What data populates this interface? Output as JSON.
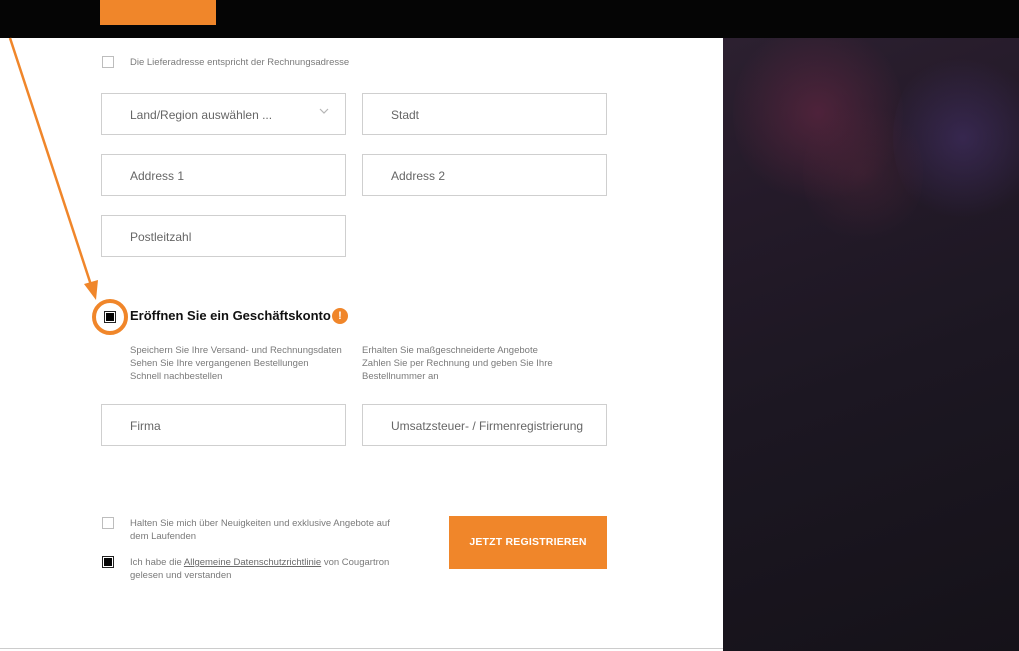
{
  "delivery": {
    "same_address_label": "Die Lieferadresse entspricht der Rechnungsadresse",
    "same_address_checked": false
  },
  "address_form": {
    "country_placeholder": "Land/Region auswählen ...",
    "city_placeholder": "Stadt",
    "address1_placeholder": "Address 1",
    "address2_placeholder": "Address 2",
    "postal_placeholder": "Postleitzahl",
    "chevron_icon": "chevron-down-icon"
  },
  "business": {
    "checked": true,
    "heading": "Eröffnen Sie ein Geschäftskonto",
    "info_icon_glyph": "!",
    "benefits_left": [
      "Speichern Sie Ihre Versand- und Rechnungsdaten",
      "Sehen Sie Ihre vergangenen Bestellungen",
      "Schnell nachbestellen"
    ],
    "benefits_right": [
      "Erhalten Sie maßgeschneiderte Angebote",
      "Zahlen Sie per Rechnung und geben Sie Ihre",
      "Bestellnummer an"
    ],
    "company_placeholder": "Firma",
    "vat_placeholder": "Umsatzsteuer- / Firmenregistrierung"
  },
  "consent": {
    "newsletter_line1": "Halten Sie mich über Neuigkeiten und exklusive Angebote auf",
    "newsletter_line2": "dem Laufenden",
    "newsletter_checked": false,
    "privacy_prefix": "Ich habe die ",
    "privacy_link": "Allgemeine Datenschutzrichtlinie",
    "privacy_suffix": " von Cougartron",
    "privacy_line2": "gelesen und verstanden",
    "privacy_checked": true
  },
  "register_button_label": "JETZT REGISTRIEREN",
  "colors": {
    "accent": "#f0862a",
    "topbar": "#050505",
    "right_panel": "#1c1722"
  }
}
